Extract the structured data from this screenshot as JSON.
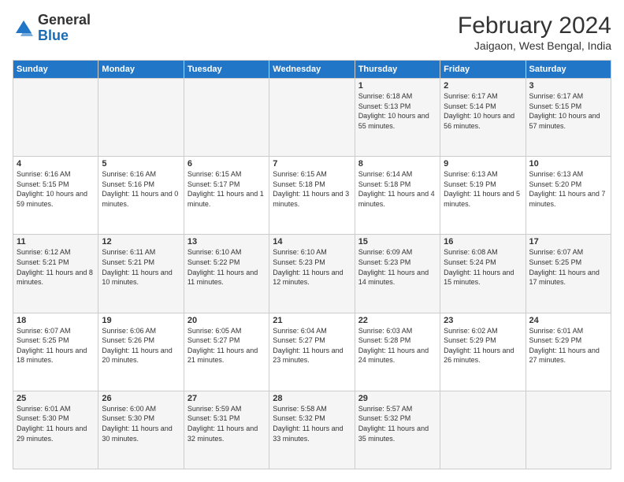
{
  "header": {
    "logo_general": "General",
    "logo_blue": "Blue",
    "month_year": "February 2024",
    "location": "Jaigaon, West Bengal, India"
  },
  "days_of_week": [
    "Sunday",
    "Monday",
    "Tuesday",
    "Wednesday",
    "Thursday",
    "Friday",
    "Saturday"
  ],
  "weeks": [
    [
      {
        "day": "",
        "info": ""
      },
      {
        "day": "",
        "info": ""
      },
      {
        "day": "",
        "info": ""
      },
      {
        "day": "",
        "info": ""
      },
      {
        "day": "1",
        "info": "Sunrise: 6:18 AM\nSunset: 5:13 PM\nDaylight: 10 hours and 55 minutes."
      },
      {
        "day": "2",
        "info": "Sunrise: 6:17 AM\nSunset: 5:14 PM\nDaylight: 10 hours and 56 minutes."
      },
      {
        "day": "3",
        "info": "Sunrise: 6:17 AM\nSunset: 5:15 PM\nDaylight: 10 hours and 57 minutes."
      }
    ],
    [
      {
        "day": "4",
        "info": "Sunrise: 6:16 AM\nSunset: 5:15 PM\nDaylight: 10 hours and 59 minutes."
      },
      {
        "day": "5",
        "info": "Sunrise: 6:16 AM\nSunset: 5:16 PM\nDaylight: 11 hours and 0 minutes."
      },
      {
        "day": "6",
        "info": "Sunrise: 6:15 AM\nSunset: 5:17 PM\nDaylight: 11 hours and 1 minute."
      },
      {
        "day": "7",
        "info": "Sunrise: 6:15 AM\nSunset: 5:18 PM\nDaylight: 11 hours and 3 minutes."
      },
      {
        "day": "8",
        "info": "Sunrise: 6:14 AM\nSunset: 5:18 PM\nDaylight: 11 hours and 4 minutes."
      },
      {
        "day": "9",
        "info": "Sunrise: 6:13 AM\nSunset: 5:19 PM\nDaylight: 11 hours and 5 minutes."
      },
      {
        "day": "10",
        "info": "Sunrise: 6:13 AM\nSunset: 5:20 PM\nDaylight: 11 hours and 7 minutes."
      }
    ],
    [
      {
        "day": "11",
        "info": "Sunrise: 6:12 AM\nSunset: 5:21 PM\nDaylight: 11 hours and 8 minutes."
      },
      {
        "day": "12",
        "info": "Sunrise: 6:11 AM\nSunset: 5:21 PM\nDaylight: 11 hours and 10 minutes."
      },
      {
        "day": "13",
        "info": "Sunrise: 6:10 AM\nSunset: 5:22 PM\nDaylight: 11 hours and 11 minutes."
      },
      {
        "day": "14",
        "info": "Sunrise: 6:10 AM\nSunset: 5:23 PM\nDaylight: 11 hours and 12 minutes."
      },
      {
        "day": "15",
        "info": "Sunrise: 6:09 AM\nSunset: 5:23 PM\nDaylight: 11 hours and 14 minutes."
      },
      {
        "day": "16",
        "info": "Sunrise: 6:08 AM\nSunset: 5:24 PM\nDaylight: 11 hours and 15 minutes."
      },
      {
        "day": "17",
        "info": "Sunrise: 6:07 AM\nSunset: 5:25 PM\nDaylight: 11 hours and 17 minutes."
      }
    ],
    [
      {
        "day": "18",
        "info": "Sunrise: 6:07 AM\nSunset: 5:25 PM\nDaylight: 11 hours and 18 minutes."
      },
      {
        "day": "19",
        "info": "Sunrise: 6:06 AM\nSunset: 5:26 PM\nDaylight: 11 hours and 20 minutes."
      },
      {
        "day": "20",
        "info": "Sunrise: 6:05 AM\nSunset: 5:27 PM\nDaylight: 11 hours and 21 minutes."
      },
      {
        "day": "21",
        "info": "Sunrise: 6:04 AM\nSunset: 5:27 PM\nDaylight: 11 hours and 23 minutes."
      },
      {
        "day": "22",
        "info": "Sunrise: 6:03 AM\nSunset: 5:28 PM\nDaylight: 11 hours and 24 minutes."
      },
      {
        "day": "23",
        "info": "Sunrise: 6:02 AM\nSunset: 5:29 PM\nDaylight: 11 hours and 26 minutes."
      },
      {
        "day": "24",
        "info": "Sunrise: 6:01 AM\nSunset: 5:29 PM\nDaylight: 11 hours and 27 minutes."
      }
    ],
    [
      {
        "day": "25",
        "info": "Sunrise: 6:01 AM\nSunset: 5:30 PM\nDaylight: 11 hours and 29 minutes."
      },
      {
        "day": "26",
        "info": "Sunrise: 6:00 AM\nSunset: 5:30 PM\nDaylight: 11 hours and 30 minutes."
      },
      {
        "day": "27",
        "info": "Sunrise: 5:59 AM\nSunset: 5:31 PM\nDaylight: 11 hours and 32 minutes."
      },
      {
        "day": "28",
        "info": "Sunrise: 5:58 AM\nSunset: 5:32 PM\nDaylight: 11 hours and 33 minutes."
      },
      {
        "day": "29",
        "info": "Sunrise: 5:57 AM\nSunset: 5:32 PM\nDaylight: 11 hours and 35 minutes."
      },
      {
        "day": "",
        "info": ""
      },
      {
        "day": "",
        "info": ""
      }
    ]
  ]
}
